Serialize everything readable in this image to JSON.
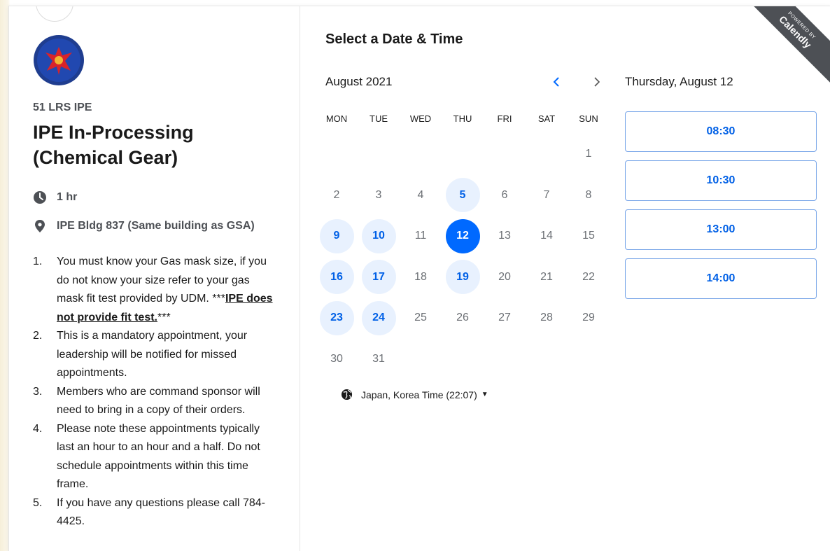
{
  "event": {
    "org_name": "51 LRS IPE",
    "title": "IPE In-Processing (Chemical Gear)",
    "duration": "1 hr",
    "location": "IPE Bldg 837 (Same building as GSA)",
    "instructions": [
      {
        "num": "1.",
        "text": "You must know your Gas mask size, if you do not know your size refer to your gas mask fit test provided by UDM. ***",
        "bold_underline": "IPE does not provide fit test.",
        "suffix": "***"
      },
      {
        "num": "2.",
        "text": "This is a mandatory appointment, your leadership will be notified for missed appointments."
      },
      {
        "num": "3.",
        "text": "Members who are command sponsor will need to bring in a copy of their orders."
      },
      {
        "num": "4.",
        "text": "Please note these appointments typically last an hour to an hour and a half. Do not schedule appointments within this time frame."
      },
      {
        "num": "5.",
        "text": "If you have any questions please call 784-4425."
      }
    ]
  },
  "calendar": {
    "section_title": "Select a Date & Time",
    "month_label": "August 2021",
    "weekdays": [
      "MON",
      "TUE",
      "WED",
      "THU",
      "FRI",
      "SAT",
      "SUN"
    ],
    "weeks": [
      [
        {
          "d": ""
        },
        {
          "d": ""
        },
        {
          "d": ""
        },
        {
          "d": ""
        },
        {
          "d": ""
        },
        {
          "d": ""
        },
        {
          "d": "1"
        }
      ],
      [
        {
          "d": "2"
        },
        {
          "d": "3"
        },
        {
          "d": "4"
        },
        {
          "d": "5",
          "s": "available"
        },
        {
          "d": "6"
        },
        {
          "d": "7"
        },
        {
          "d": "8"
        }
      ],
      [
        {
          "d": "9",
          "s": "available"
        },
        {
          "d": "10",
          "s": "available"
        },
        {
          "d": "11"
        },
        {
          "d": "12",
          "s": "selected"
        },
        {
          "d": "13"
        },
        {
          "d": "14"
        },
        {
          "d": "15"
        }
      ],
      [
        {
          "d": "16",
          "s": "available"
        },
        {
          "d": "17",
          "s": "available"
        },
        {
          "d": "18"
        },
        {
          "d": "19",
          "s": "available"
        },
        {
          "d": "20"
        },
        {
          "d": "21"
        },
        {
          "d": "22"
        }
      ],
      [
        {
          "d": "23",
          "s": "available"
        },
        {
          "d": "24",
          "s": "available"
        },
        {
          "d": "25"
        },
        {
          "d": "26"
        },
        {
          "d": "27"
        },
        {
          "d": "28"
        },
        {
          "d": "29"
        }
      ],
      [
        {
          "d": "30"
        },
        {
          "d": "31"
        },
        {
          "d": ""
        },
        {
          "d": ""
        },
        {
          "d": ""
        },
        {
          "d": ""
        },
        {
          "d": ""
        }
      ]
    ],
    "timezone": "Japan, Korea Time (22:07)"
  },
  "times": {
    "selected_date": "Thursday, August 12",
    "slots": [
      "08:30",
      "10:30",
      "13:00",
      "14:00"
    ]
  },
  "branding": {
    "powered_by": "POWERED BY",
    "brand": "Calendly"
  },
  "colors": {
    "accent": "#0069ff",
    "available_bg": "#e8f1fe",
    "available_text": "#0060e6"
  }
}
